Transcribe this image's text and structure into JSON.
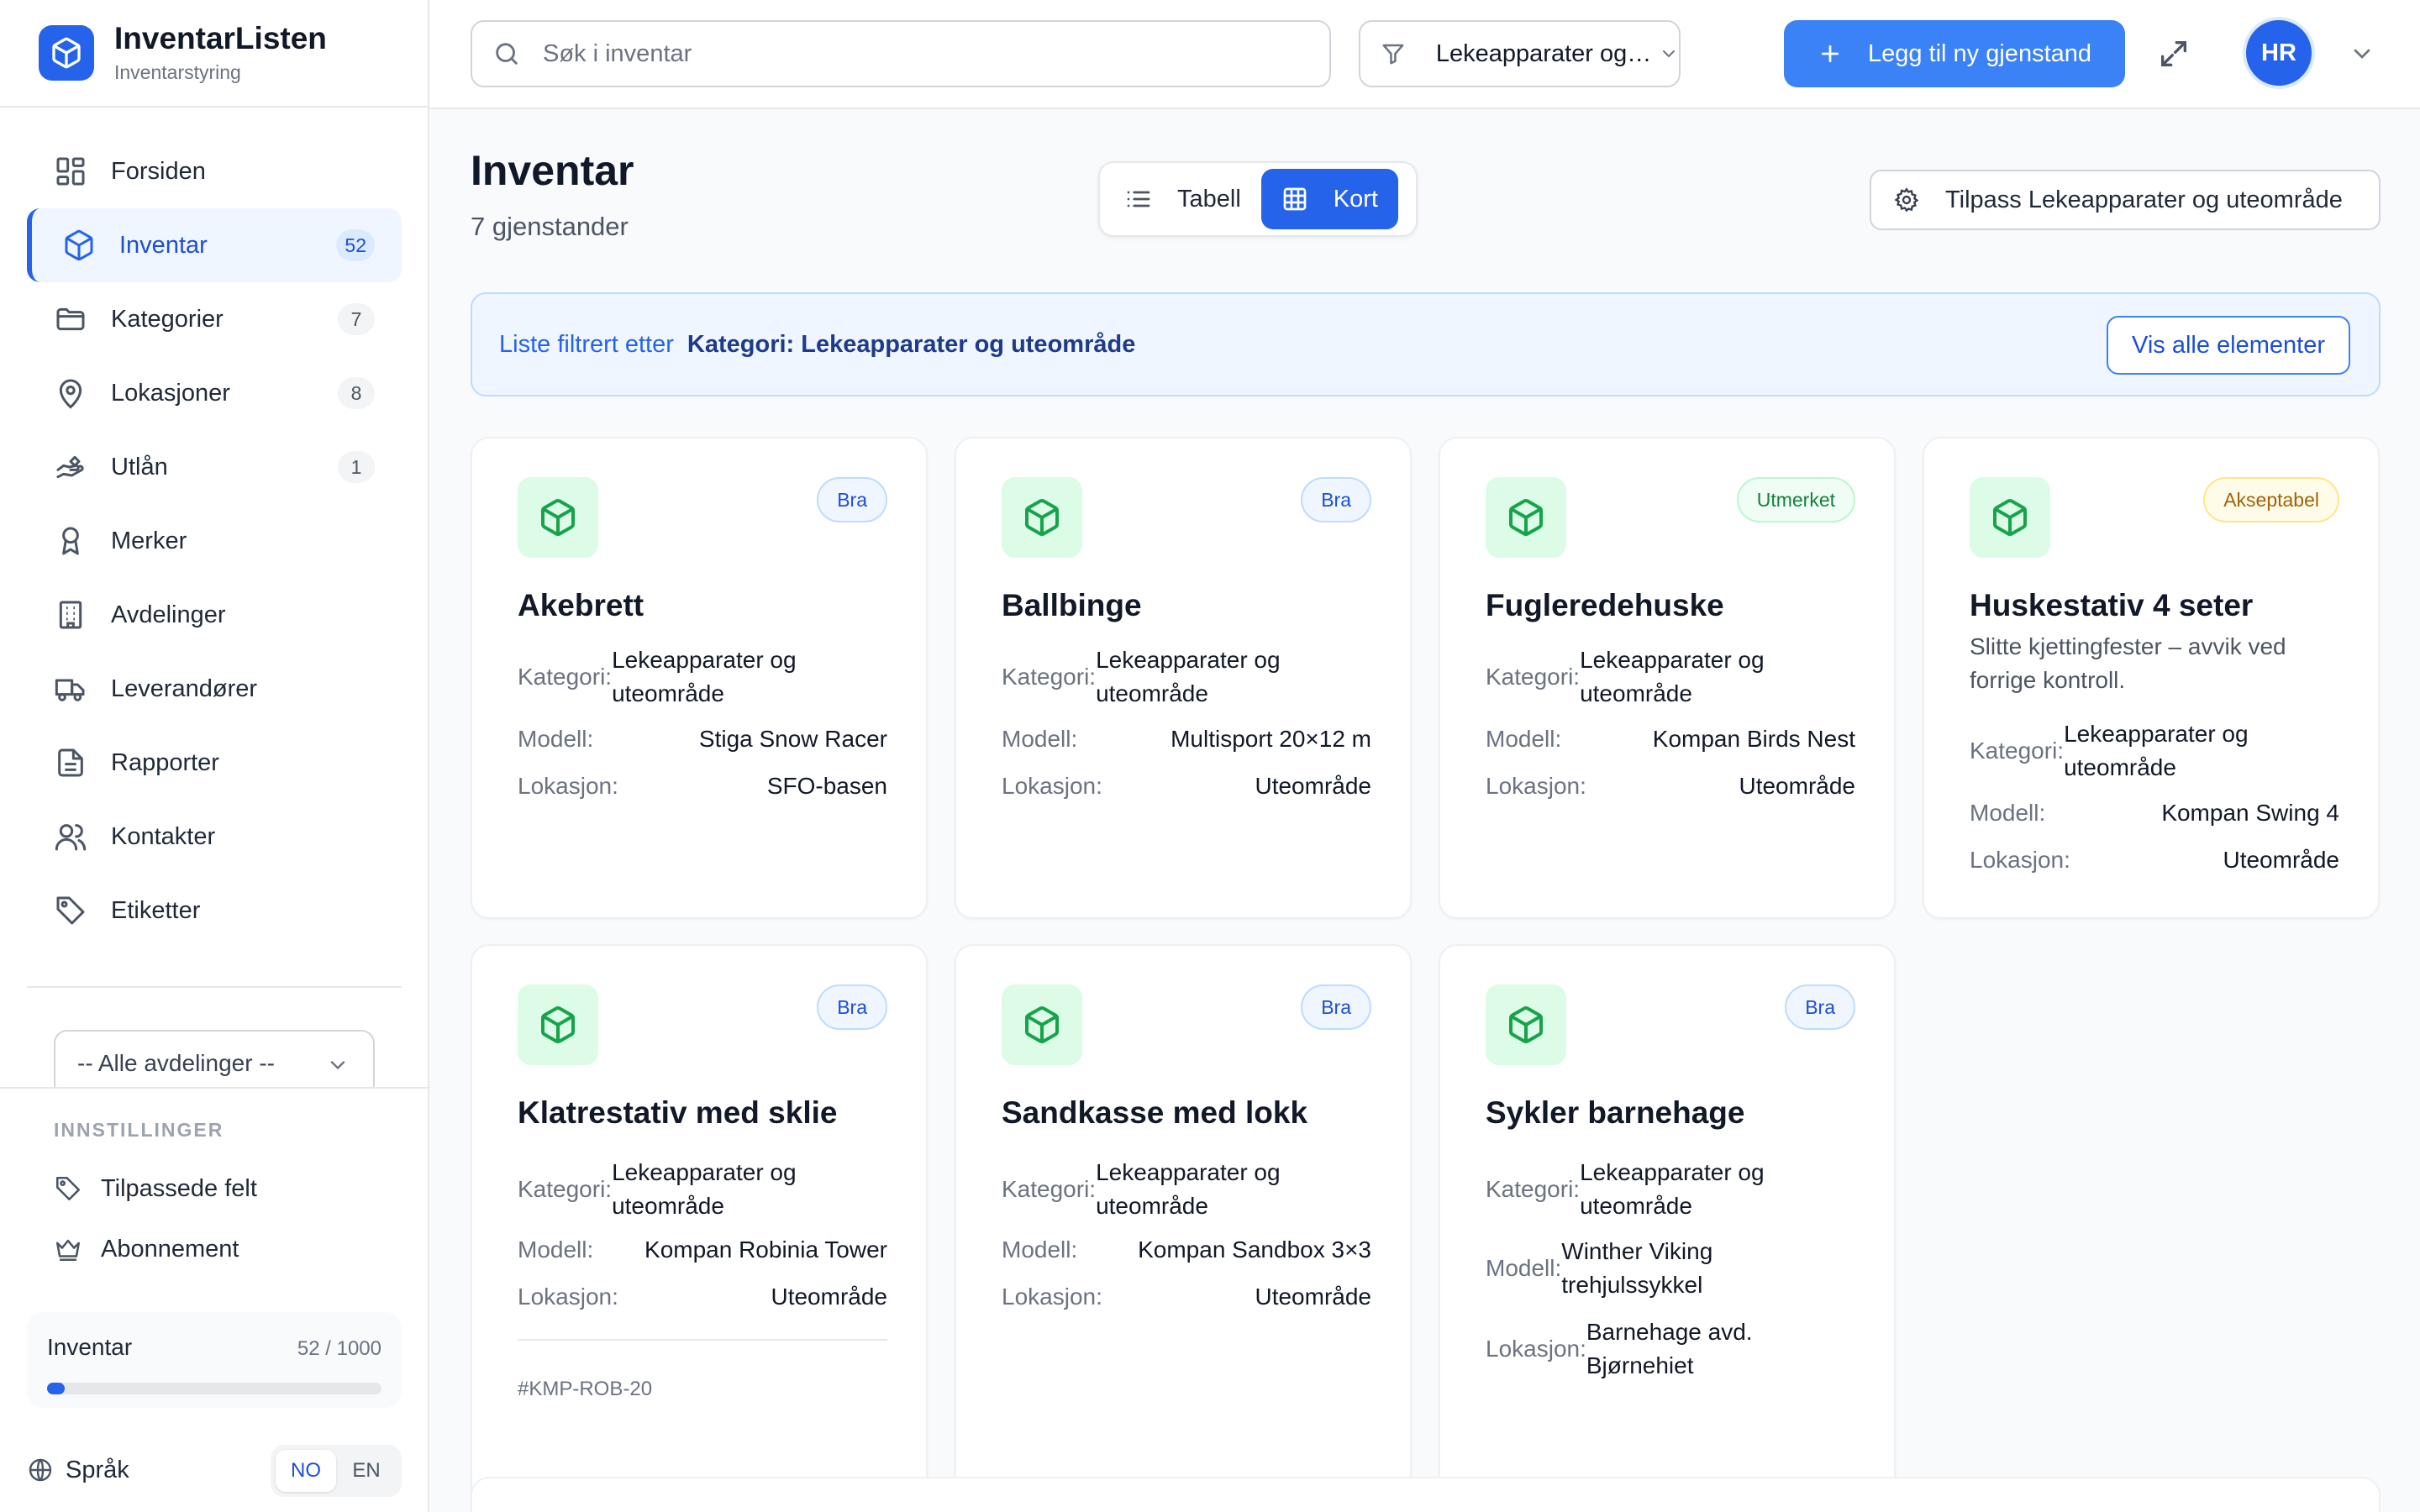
{
  "brand": {
    "title": "InventarListen",
    "subtitle": "Inventarstyring"
  },
  "nav": [
    {
      "label": "Forsiden",
      "icon": "dashboard-icon"
    },
    {
      "label": "Inventar",
      "icon": "box-icon",
      "count": "52",
      "active": true
    },
    {
      "label": "Kategorier",
      "icon": "folder-icon",
      "count": "7"
    },
    {
      "label": "Lokasjoner",
      "icon": "map-pin-icon",
      "count": "8"
    },
    {
      "label": "Utlån",
      "icon": "hand-icon",
      "count": "1"
    },
    {
      "label": "Merker",
      "icon": "award-icon"
    },
    {
      "label": "Avdelinger",
      "icon": "building-icon"
    },
    {
      "label": "Leverandører",
      "icon": "truck-icon"
    },
    {
      "label": "Rapporter",
      "icon": "file-text-icon"
    },
    {
      "label": "Kontakter",
      "icon": "users-icon"
    },
    {
      "label": "Etiketter",
      "icon": "tag-icon"
    }
  ],
  "department_select": "-- Alle avdelinger --",
  "settings": {
    "heading": "INNSTILLINGER",
    "custom_fields": "Tilpassede felt",
    "subscription": "Abonnement"
  },
  "quota": {
    "label": "Inventar",
    "used": "52",
    "sep": " / ",
    "total": "1000",
    "fraction": 0.052
  },
  "language": {
    "label": "Språk",
    "no": "NO",
    "en": "EN",
    "active": "NO"
  },
  "topbar": {
    "search_placeholder": "Søk i inventar",
    "filter_value": "Lekeapparater og uteområde",
    "add_button": "Legg til ny gjenstand",
    "avatar_initials": "HR"
  },
  "main": {
    "title": "Inventar",
    "count": "7 gjenstander",
    "view_table": "Tabell",
    "view_cards": "Kort",
    "customize_button": "Tilpass Lekeapparater og uteområde",
    "filter_banner_prefix": "Liste filtrert etter",
    "filter_banner_value": "Kategori: Lekeapparater og uteområde",
    "show_all_button": "Vis alle elementer"
  },
  "labels": {
    "category": "Kategori:",
    "model": "Modell:",
    "location": "Lokasjon:"
  },
  "items": [
    {
      "name": "Akebrett",
      "condition": "Bra",
      "category": "Lekeapparater og uteområde",
      "model": "Stiga Snow Racer",
      "location": "SFO-basen"
    },
    {
      "name": "Ballbinge",
      "condition": "Bra",
      "category": "Lekeapparater og uteområde",
      "model": "Multisport 20×12 m",
      "location": "Uteområde"
    },
    {
      "name": "Fugleredehuske",
      "condition": "Utmerket",
      "category": "Lekeapparater og uteområde",
      "model": "Kompan Birds Nest",
      "location": "Uteområde"
    },
    {
      "name": "Huskestativ 4 seter",
      "condition": "Akseptabel",
      "description": "Slitte kjettingfester – avvik ved forrige kontroll.",
      "category": "Lekeapparater og uteområde",
      "model": "Kompan Swing 4",
      "location": "Uteområde"
    },
    {
      "name": "Klatrestativ med sklie",
      "condition": "Bra",
      "category": "Lekeapparater og uteområde",
      "model": "Kompan Robinia Tower",
      "location": "Uteområde",
      "sku": "#KMP-ROB-20"
    },
    {
      "name": "Sandkasse med lokk",
      "condition": "Bra",
      "category": "Lekeapparater og uteområde",
      "model": "Kompan Sandbox 3×3",
      "location": "Uteområde"
    },
    {
      "name": "Sykler barnehage",
      "condition": "Bra",
      "category": "Lekeapparater og uteområde",
      "model": "Winther Viking trehjulssykkel",
      "location": "Barnehage avd. Bjørnehiet"
    }
  ],
  "colors": {
    "accent": "#2563eb",
    "accent_light": "#eff6ff",
    "item_icon_bg": "#dcfce7",
    "item_icon": "#16a34a"
  }
}
